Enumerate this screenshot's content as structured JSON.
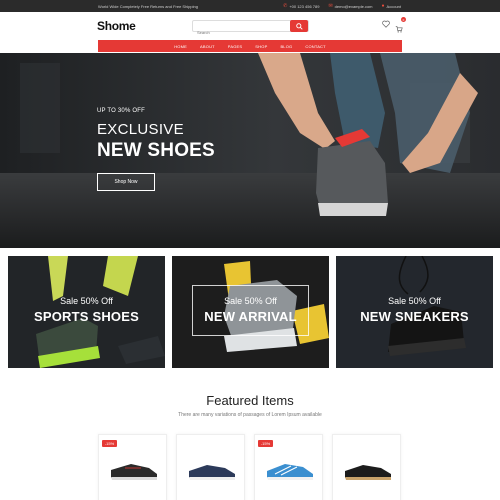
{
  "topbar": {
    "welcome": "World Wide Completely Free Returns and Free Shipping",
    "phone": "+00 123 456 789",
    "email": "demo@example.com",
    "account": "Account"
  },
  "header": {
    "logo": "Shome",
    "search_placeholder": "Search",
    "cart_count": "0"
  },
  "nav": {
    "items": [
      "HOME",
      "ABOUT",
      "PAGES",
      "SHOP",
      "BLOG",
      "CONTACT"
    ]
  },
  "hero": {
    "subtitle": "UP TO 30% OFF",
    "title_line1": "EXCLUSIVE",
    "title_line2": "NEW SHOES",
    "button": "Shop Now"
  },
  "banners": [
    {
      "sale": "Sale 50% Off",
      "title": "SPORTS SHOES"
    },
    {
      "sale": "Sale 50% Off",
      "title": "NEW ARRIVAL"
    },
    {
      "sale": "Sale 50% Off",
      "title": "NEW SNEAKERS"
    }
  ],
  "featured": {
    "title": "Featured Items",
    "subtitle": "There are many variations of passages of Lorem Ipsum available",
    "products": [
      {
        "badge": "-15%"
      },
      {
        "badge": ""
      },
      {
        "badge": "-15%"
      },
      {
        "badge": ""
      }
    ]
  },
  "colors": {
    "accent": "#e53935",
    "topbar": "#2b2b2b"
  }
}
